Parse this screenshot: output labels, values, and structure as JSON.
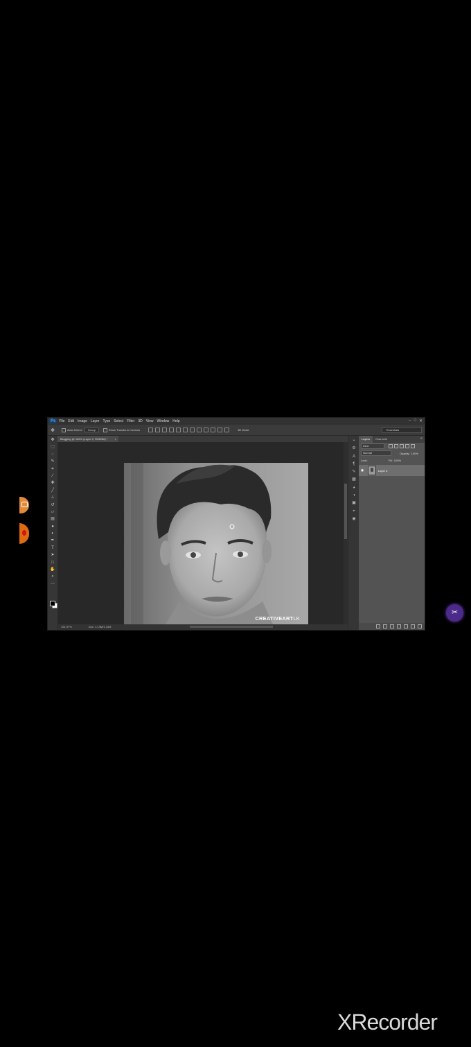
{
  "photoshop": {
    "logo": "Ps",
    "menu": [
      "File",
      "Edit",
      "Image",
      "Layer",
      "Type",
      "Select",
      "Filter",
      "3D",
      "View",
      "Window",
      "Help"
    ],
    "window_controls": [
      "–",
      "□",
      "✕"
    ],
    "options_bar": {
      "auto_select_label": "Auto-Select:",
      "auto_select_value": "Group",
      "transform_label": "Show Transform Controls",
      "mode_label": "3D Mode:",
      "workspace": "Essentials"
    },
    "document_tab": {
      "label": "Blogging @ 152% (Layer 0, RGB/8#) *",
      "close": "×"
    },
    "status_bar": {
      "zoom": "151.97%",
      "doc_info": "Doc: 1.14M/1.14M"
    },
    "watermark": {
      "bold": "CREATIVEART",
      "suffix": "LK"
    },
    "layers_panel": {
      "tabs": [
        "Layers",
        "Channels"
      ],
      "filter_kind": "Kind",
      "blend_mode": "Normal",
      "opacity_label": "Opacity:",
      "opacity_value": "100%",
      "lock_label": "Lock:",
      "fill_label": "Fill:",
      "fill_value": "100%",
      "layers": [
        {
          "name": "Layer 0",
          "visible": true
        }
      ]
    }
  },
  "overlay": {
    "brand": "XRecorder",
    "float_icon": "recorder-tools-icon"
  },
  "colors": {
    "background": "#000000",
    "ps_panel": "#535353",
    "ps_canvas_bg": "#282828",
    "recorder_accent": "#e07a20",
    "float_button": "#4b2a8a"
  }
}
